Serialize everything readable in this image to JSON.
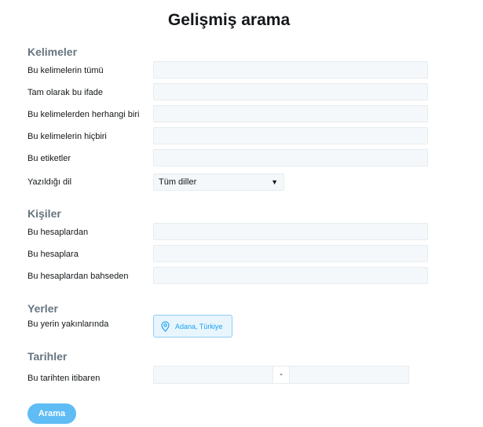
{
  "title": "Gelişmiş arama",
  "sections": {
    "words": {
      "heading": "Kelimeler",
      "all_words": "Bu kelimelerin tümü",
      "exact_phrase": "Tam olarak bu ifade",
      "any_words": "Bu kelimelerden herhangi biri",
      "none_words": "Bu kelimelerin hiçbiri",
      "hashtags": "Bu etiketler",
      "language_label": "Yazıldığı dil",
      "language_value": "Tüm diller"
    },
    "people": {
      "heading": "Kişiler",
      "from_accounts": "Bu hesaplardan",
      "to_accounts": "Bu hesaplara",
      "mentioning_accounts": "Bu hesaplardan bahseden"
    },
    "places": {
      "heading": "Yerler",
      "near_label": "Bu yerin yakınlarında",
      "near_value": "Adana, Türkiye"
    },
    "dates": {
      "heading": "Tarihler",
      "from_label": "Bu tarihten itibaren",
      "separator": "-"
    }
  },
  "search_button": "Arama",
  "colors": {
    "accent": "#1da1f2",
    "section_heading": "#66757f",
    "field_bg": "#f5f8fa"
  }
}
